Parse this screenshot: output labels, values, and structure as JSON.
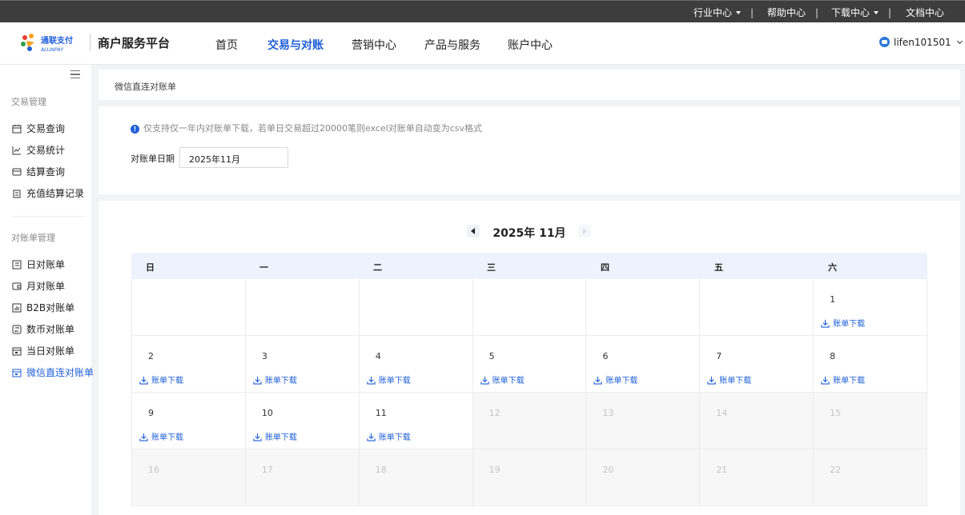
{
  "topbar": {
    "industry": "行业中心",
    "help": "帮助中心",
    "download": "下载中心",
    "docs": "文档中心",
    "separator": "|"
  },
  "header": {
    "logo_text": "通联支付",
    "logo_sub": "ALLINPAY",
    "platform": "商户服务平台",
    "nav": [
      "首页",
      "交易与对账",
      "营销中心",
      "产品与服务",
      "账户中心"
    ],
    "active_nav": "交易与对账",
    "username": "lifen101501"
  },
  "sidebar": {
    "groups": [
      {
        "title": "交易管理",
        "items": [
          "交易查询",
          "交易统计",
          "结算查询",
          "充值结算记录"
        ]
      },
      {
        "title": "对账单管理",
        "items": [
          "日对账单",
          "月对账单",
          "B2B对账单",
          "数币对账单",
          "当日对账单",
          "微信直连对账单"
        ]
      }
    ],
    "active_item": "微信直连对账单"
  },
  "breadcrumb": "微信直连对账单",
  "filter": {
    "notice": "仅支持仅一年内对账单下载，若单日交易超过20000笔则excel对账单自动变为csv格式",
    "date_label": "对账单日期",
    "date_value": "2025年11月"
  },
  "calendar": {
    "title": "2025年 11月",
    "weekdays": [
      "日",
      "一",
      "二",
      "三",
      "四",
      "五",
      "六"
    ],
    "download_label": "账单下载",
    "weeks": [
      [
        null,
        null,
        null,
        null,
        null,
        null,
        {
          "day": "1",
          "download": true
        }
      ],
      [
        {
          "day": "2",
          "download": true
        },
        {
          "day": "3",
          "download": true
        },
        {
          "day": "4",
          "download": true
        },
        {
          "day": "5",
          "download": true
        },
        {
          "day": "6",
          "download": true
        },
        {
          "day": "7",
          "download": true
        },
        {
          "day": "8",
          "download": true
        }
      ],
      [
        {
          "day": "9",
          "download": true
        },
        {
          "day": "10",
          "download": true
        },
        {
          "day": "11",
          "download": true
        },
        {
          "day": "12",
          "disabled": true
        },
        {
          "day": "13",
          "disabled": true
        },
        {
          "day": "14",
          "disabled": true
        },
        {
          "day": "15",
          "disabled": true
        }
      ],
      [
        {
          "day": "16",
          "disabled": true
        },
        {
          "day": "17",
          "disabled": true
        },
        {
          "day": "18",
          "disabled": true
        },
        {
          "day": "19",
          "disabled": true
        },
        {
          "day": "20",
          "disabled": true
        },
        {
          "day": "21",
          "disabled": true
        },
        {
          "day": "22",
          "disabled": true
        }
      ]
    ]
  },
  "colors": {
    "accent": "#1f5fd8",
    "topbar": "#3d3d3d",
    "table_header": "#ecf3fd"
  }
}
